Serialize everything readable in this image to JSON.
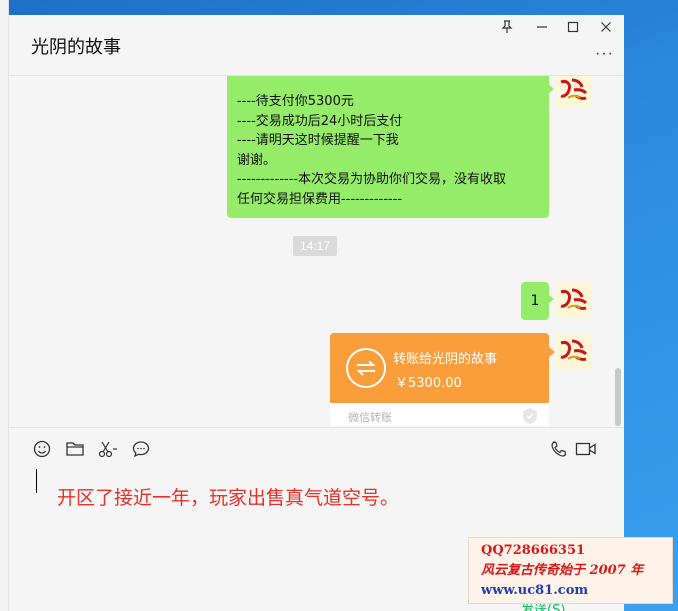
{
  "window": {
    "title": "光阴的故事",
    "controls": {
      "pin": "pin-icon",
      "minimize": "minimize-icon",
      "maximize": "maximize-icon",
      "close": "close-icon"
    },
    "more_label": "···"
  },
  "messages": {
    "text_block_lines": [
      "----待支付你5300元",
      "----交易成功后24小时后支付",
      "----请明天这时候提醒一下我",
      "谢谢。",
      "-------------本次交易为协助你们交易，没有收取",
      "任何交易担保费用-------------"
    ],
    "timestamp": "14:17",
    "short_reply": "1",
    "transfer": {
      "title": "转账给光阴的故事",
      "amount": "￥5300.00",
      "footer": "微信转账"
    }
  },
  "toolbar": {
    "left_icons": [
      "emoji-icon",
      "folder-icon",
      "scissors-icon",
      "chat-bubble-icon"
    ],
    "right_icons": [
      "phone-icon",
      "video-icon"
    ]
  },
  "input": {
    "text": "开区了接近一年，玩家出售真气道空号。",
    "send_hint": "发送(S)"
  },
  "watermark": {
    "line1": "QQ728666351",
    "line2": "风云复古传奇始于 2007 年",
    "line3": "www.uc81.com"
  },
  "colors": {
    "bubble_green": "#95ec69",
    "transfer_orange": "#fa9d3b",
    "input_text": "#e8302a",
    "desktop_blue": "#2a8ae0"
  }
}
